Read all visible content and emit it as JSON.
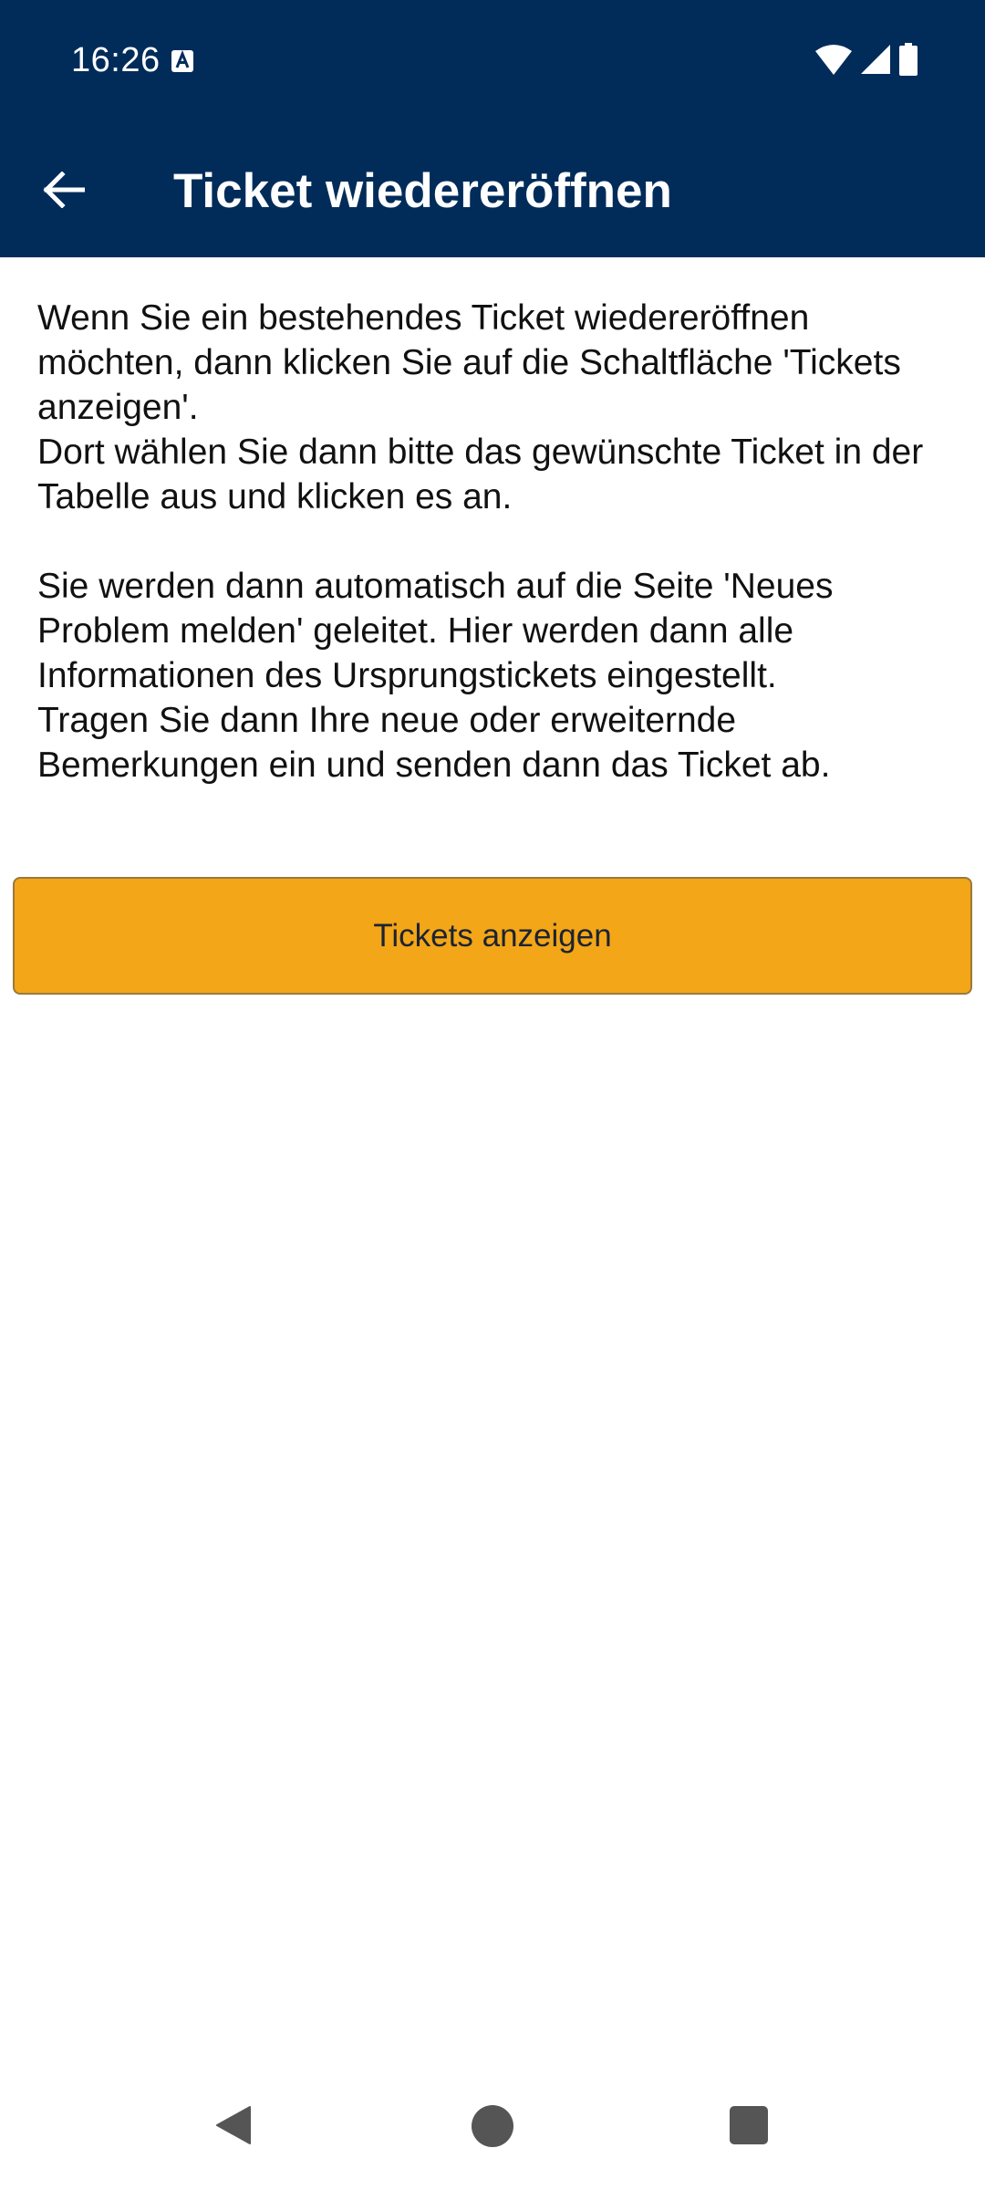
{
  "status_bar": {
    "time": "16:26",
    "icons": [
      "a-notification-icon",
      "wifi-icon",
      "signal-icon",
      "battery-icon"
    ]
  },
  "app_bar": {
    "title": "Ticket wiedereröffnen",
    "back_icon": "arrow-left-icon"
  },
  "content": {
    "paragraph_1": [
      "Wenn Sie ein bestehendes Ticket wiedereröffnen möchten, dann klicken Sie auf die Schaltfläche 'Tickets anzeigen'.",
      "Dort wählen Sie dann bitte das gewünschte Ticket in der Tabelle aus und klicken es an."
    ],
    "paragraph_2": [
      "Sie werden dann automatisch auf die Seite 'Neues Problem melden' geleitet. Hier werden dann alle Informationen des Ursprungstickets eingestellt.",
      "Tragen Sie dann Ihre neue oder erweiternde Bemerkungen ein und senden dann das Ticket ab."
    ]
  },
  "actions": {
    "show_tickets_label": "Tickets anzeigen"
  },
  "nav_bar": {
    "icons": [
      "nav-back-icon",
      "nav-home-icon",
      "nav-recents-icon"
    ]
  },
  "colors": {
    "primary": "#012c5a",
    "accent": "#f3a617",
    "text": "#111111"
  }
}
